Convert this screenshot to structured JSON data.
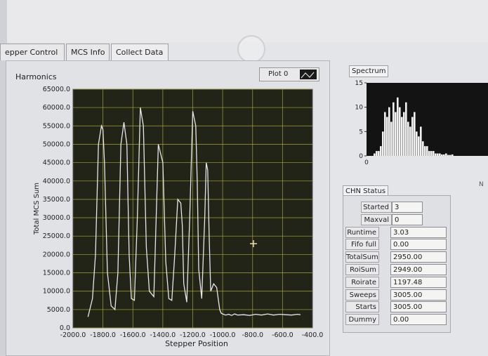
{
  "tabs": [
    {
      "label": "epper Control",
      "active": false
    },
    {
      "label": "MCS Info",
      "active": false
    },
    {
      "label": "Collect Data",
      "active": true
    }
  ],
  "harmonics": {
    "title": "Harmonics",
    "legend_label": "Plot 0",
    "xlabel": "Stepper Position",
    "ylabel": "Total MCS Sum",
    "x_ticks": [
      "-2000.0",
      "-1800.0",
      "-1600.0",
      "-1400.0",
      "-1200.0",
      "-1000.0",
      "-800.0",
      "-600.0",
      "-400.0"
    ],
    "y_ticks": [
      "65000.0",
      "60000.0",
      "55000.0",
      "50000.0",
      "45000.0",
      "40000.0",
      "35000.0",
      "30000.0",
      "25000.0",
      "20000.0",
      "15000.0",
      "10000.0",
      "5000.0",
      "0.0"
    ]
  },
  "spectrum": {
    "title": "Spectrum",
    "y_ticks": [
      "15",
      "10",
      "5",
      "0"
    ],
    "x_ticks": [
      "0"
    ]
  },
  "chn_status": {
    "title": "CHN Status",
    "rows": [
      {
        "label": "Started",
        "value": "3"
      },
      {
        "label": "Maxval",
        "value": "0"
      },
      {
        "label": "Runtime",
        "value": "3.03"
      },
      {
        "label": "Fifo full",
        "value": "0.00"
      },
      {
        "label": "TotalSum",
        "value": "2950.00"
      },
      {
        "label": "RoiSum",
        "value": "2949.00"
      },
      {
        "label": "Roirate",
        "value": "1197.48"
      },
      {
        "label": "Sweeps",
        "value": "3005.00"
      },
      {
        "label": "Starts",
        "value": "3005.00"
      },
      {
        "label": "Dummy",
        "value": "0.00"
      }
    ]
  },
  "right_stub_label": "N",
  "chart_data": [
    {
      "type": "line",
      "xlabel": "Stepper Position",
      "ylabel": "Total MCS Sum",
      "xlim": [
        -2000,
        -400
      ],
      "ylim": [
        0,
        65000
      ],
      "grid": true,
      "series": [
        {
          "name": "Plot 0",
          "x": [
            -1900,
            -1870,
            -1850,
            -1830,
            -1810,
            -1800,
            -1790,
            -1770,
            -1745,
            -1720,
            -1700,
            -1680,
            -1660,
            -1640,
            -1625,
            -1610,
            -1590,
            -1570,
            -1550,
            -1530,
            -1510,
            -1490,
            -1470,
            -1460,
            -1450,
            -1430,
            -1400,
            -1380,
            -1360,
            -1340,
            -1320,
            -1300,
            -1280,
            -1270,
            -1260,
            -1240,
            -1220,
            -1200,
            -1180,
            -1170,
            -1160,
            -1140,
            -1120,
            -1110,
            -1100,
            -1090,
            -1080,
            -1060,
            -1040,
            -1020,
            -1010,
            -1000,
            -980,
            -960,
            -940,
            -920,
            -900,
            -860,
            -820,
            -780,
            -740,
            -700,
            -660,
            -620,
            -580,
            -540,
            -500,
            -480
          ],
          "y": [
            3000,
            8000,
            20000,
            50000,
            55000,
            54000,
            45000,
            15000,
            6000,
            5000,
            15000,
            50000,
            56000,
            50000,
            20000,
            8000,
            7500,
            30000,
            60000,
            55000,
            22000,
            10000,
            9000,
            8500,
            22000,
            50000,
            45000,
            18000,
            8000,
            7500,
            20000,
            35000,
            34000,
            28000,
            12000,
            7000,
            30000,
            59000,
            55000,
            40000,
            16000,
            8000,
            30000,
            45000,
            43000,
            25000,
            10000,
            12000,
            11000,
            5000,
            4000,
            3800,
            3500,
            3700,
            3400,
            3800,
            3500,
            3600,
            3400,
            3700,
            3500,
            3800,
            3500,
            3700,
            3600,
            3500,
            3700,
            3600
          ]
        }
      ]
    },
    {
      "type": "bar",
      "title": "Spectrum",
      "ylim": [
        0,
        15
      ],
      "values": [
        0.5,
        1,
        1,
        2,
        5,
        9,
        8,
        10,
        7,
        11,
        9,
        12,
        10,
        8,
        9,
        11,
        7,
        6,
        8,
        9,
        5,
        4,
        6,
        3,
        2,
        2,
        1,
        1,
        1,
        0.5,
        0.5,
        0.5,
        0.3,
        0.3,
        0.5,
        0.2,
        0.2,
        0.3
      ]
    }
  ]
}
